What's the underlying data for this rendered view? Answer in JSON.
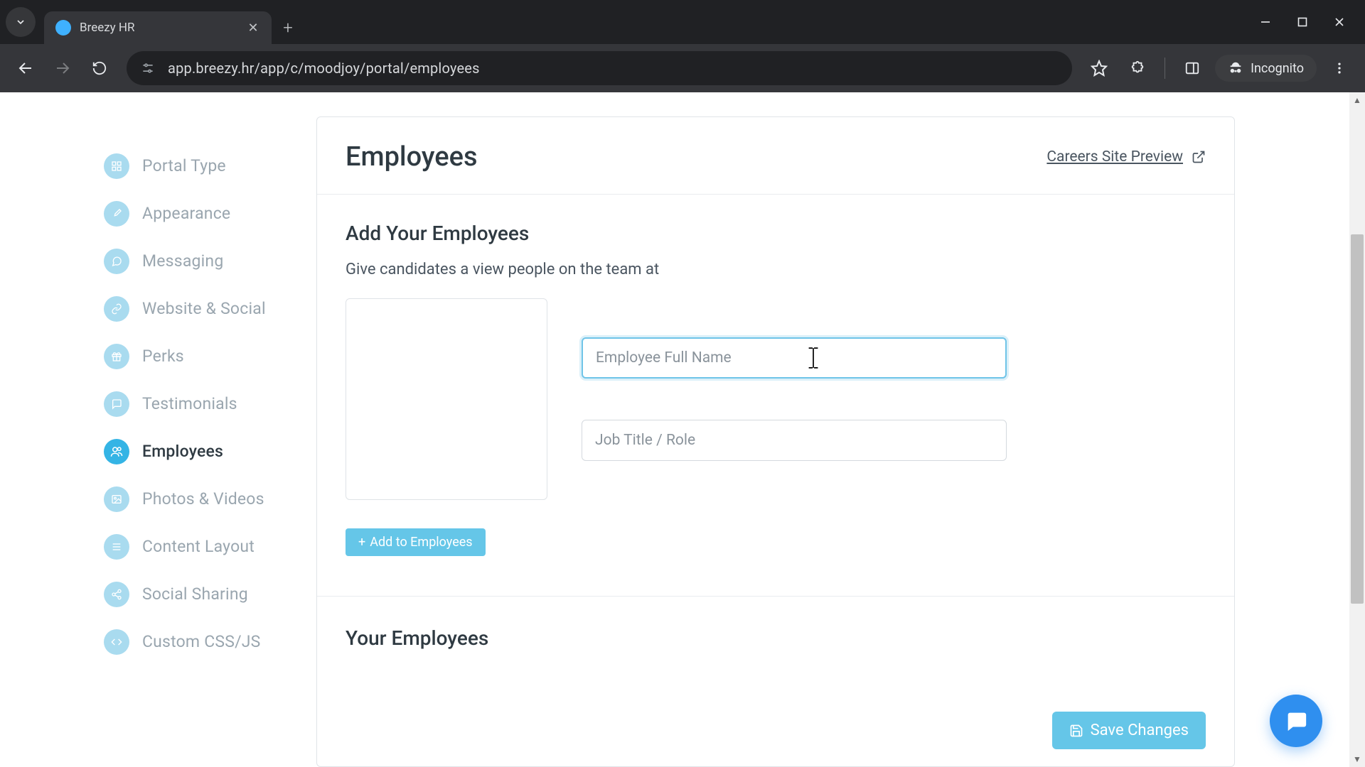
{
  "browser": {
    "tab_title": "Breezy HR",
    "url": "app.breezy.hr/app/c/moodjoy/portal/employees",
    "incognito_label": "Incognito"
  },
  "sidebar": {
    "items": [
      {
        "label": "Portal Type"
      },
      {
        "label": "Appearance"
      },
      {
        "label": "Messaging"
      },
      {
        "label": "Website & Social"
      },
      {
        "label": "Perks"
      },
      {
        "label": "Testimonials"
      },
      {
        "label": "Employees"
      },
      {
        "label": "Photos & Videos"
      },
      {
        "label": "Content Layout"
      },
      {
        "label": "Social Sharing"
      },
      {
        "label": "Custom CSS/JS"
      }
    ],
    "active_index": 6
  },
  "header": {
    "title": "Employees",
    "preview_label": "Careers Site Preview"
  },
  "add_section": {
    "title": "Add Your Employees",
    "description": "Give candidates a view people on the team at",
    "name_placeholder": "Employee Full Name",
    "role_placeholder": "Job Title / Role",
    "add_button_label": "Add to Employees"
  },
  "list_section": {
    "title": "Your Employees"
  },
  "footer": {
    "save_label": "Save Changes"
  }
}
